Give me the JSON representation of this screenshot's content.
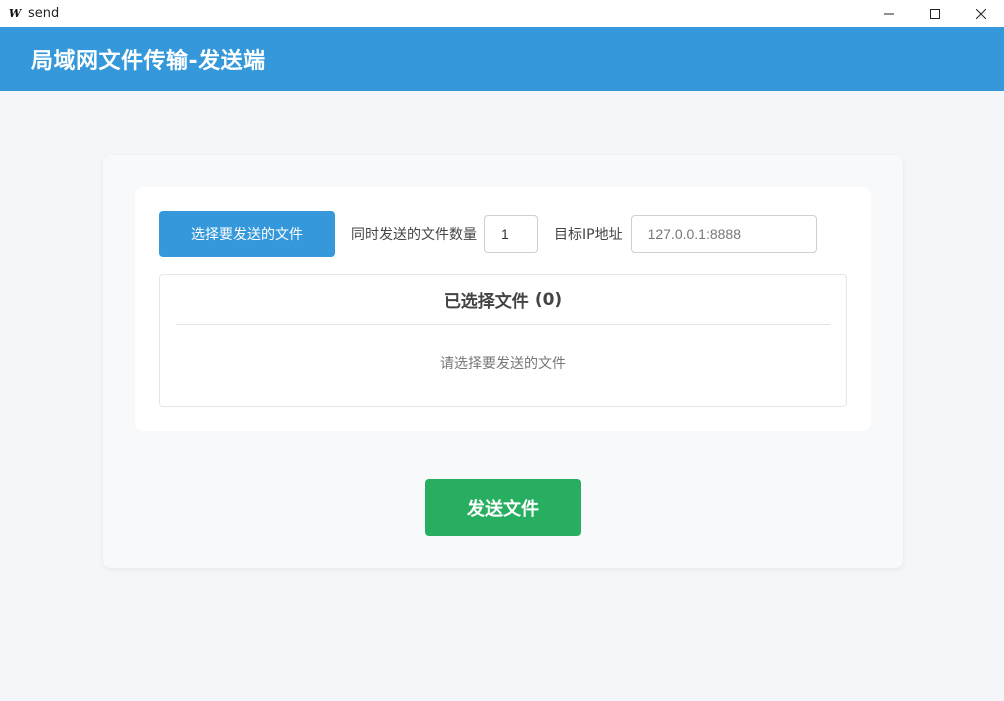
{
  "window": {
    "app_icon": "W",
    "title": "send",
    "controls": [
      "minimize-icon",
      "maximize-icon",
      "close-icon"
    ]
  },
  "header": {
    "title": "局域网文件传输-发送端"
  },
  "controls": {
    "choose_button_label": "选择要发送的文件",
    "count_label": "同时发送的文件数量",
    "count_value": "1",
    "ip_label": "目标IP地址",
    "ip_placeholder": "127.0.0.1:8888"
  },
  "file_list": {
    "title": "已选择文件",
    "count": "(0)",
    "empty_hint": "请选择要发送的文件"
  },
  "send_button_label": "发送文件",
  "colors": {
    "header": "#3498db",
    "primary_button": "#3498db",
    "send_button": "#27ae60",
    "background": "#f4f6f9"
  }
}
